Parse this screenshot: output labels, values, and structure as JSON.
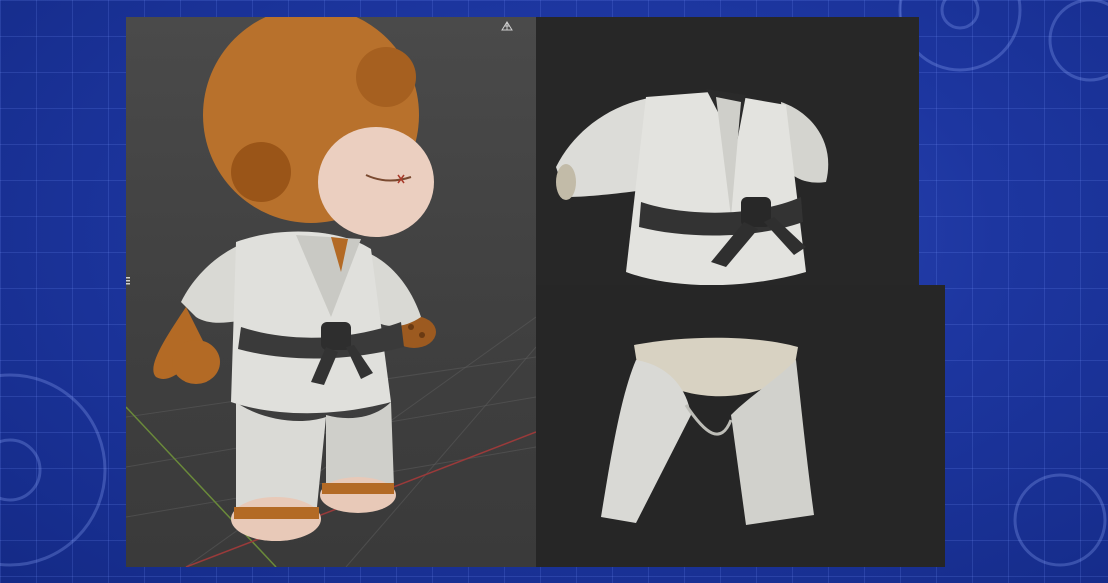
{
  "scene": {
    "background_color": "#1d36a0",
    "viewport_color": "#444444",
    "render_bg_color": "#272727",
    "icons": [
      "mesh-grid-icon",
      "gear-decoration",
      "panel-handle-icon"
    ]
  },
  "panels": {
    "viewport": {
      "subject": "plush-doll-in-karate-gi"
    },
    "render_top": {
      "subject": "karate-gi-jacket-with-black-belt"
    },
    "render_bottom": {
      "subject": "karate-gi-pants"
    }
  }
}
